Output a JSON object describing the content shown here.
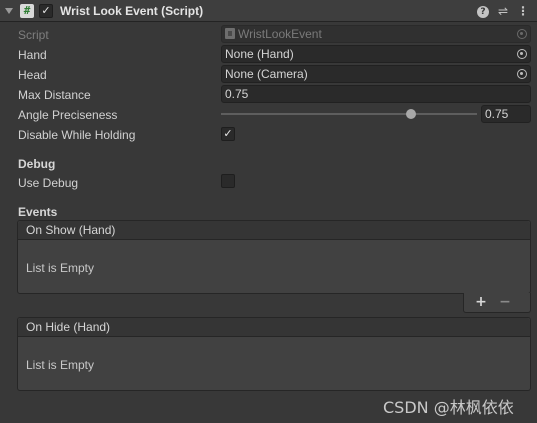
{
  "header": {
    "title": "Wrist Look Event (Script)",
    "enabled_check": "✓",
    "script_icon_glyph": "#",
    "icons": [
      "foldout-arrow-icon",
      "script-icon",
      "help-icon",
      "presets-icon",
      "menu-icon"
    ]
  },
  "fields": {
    "script": {
      "label": "Script",
      "value": "WristLookEvent"
    },
    "hand": {
      "label": "Hand",
      "value": "None (Hand)"
    },
    "head": {
      "label": "Head",
      "value": "None (Camera)"
    },
    "max_distance": {
      "label": "Max Distance",
      "value": "0.75"
    },
    "angle_preciseness": {
      "label": "Angle Preciseness",
      "value": "0.75",
      "slider_fraction": 0.75
    },
    "disable_while_holding": {
      "label": "Disable While Holding",
      "checked": true,
      "check": "✓"
    }
  },
  "debug": {
    "heading": "Debug",
    "use_debug": {
      "label": "Use Debug",
      "checked": false
    }
  },
  "events": {
    "heading": "Events",
    "on_show": {
      "title": "On Show (Hand)",
      "empty": "List is Empty"
    },
    "on_hide": {
      "title": "On Hide (Hand)",
      "empty": "List is Empty"
    },
    "add_label": "+",
    "remove_label": "−"
  },
  "watermark": "CSDN @林枫依依",
  "colors": {
    "background": "#383838",
    "header": "#3e3e3e",
    "field": "#2a2a2a",
    "text": "#d2d2d2"
  }
}
